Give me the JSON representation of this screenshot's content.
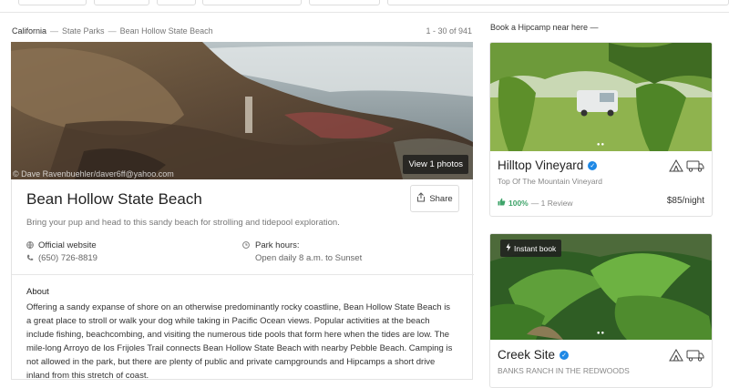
{
  "breadcrumb": [
    "California",
    "State Parks",
    "Bean Hollow State Beach"
  ],
  "result_count": "1 - 30 of 941",
  "hero": {
    "credit": "© Dave Ravenbuehler/daver6ff@yahoo.com",
    "view_photos_label": "View 1 photos"
  },
  "park": {
    "title": "Bean Hollow State Beach",
    "share_label": "Share",
    "tagline": "Bring your pup and head to this sandy beach for strolling and tidepool exploration.",
    "website_label": "Official website",
    "phone": "(650) 726-8819",
    "hours_label": "Park hours:",
    "hours_value": "Open daily 8 a.m. to Sunset",
    "about_heading": "About",
    "about_text": "Offering a sandy expanse of shore on an otherwise predominantly rocky coastline, Bean Hollow State Beach is a great place to stroll or walk your dog while taking in Pacific Ocean views. Popular activities at the beach include fishing, beachcombing, and visiting the numerous tide pools that form here when the tides are low. The mile-long Arroyo de los Frijoles Trail connects Bean Hollow State Beach with nearby Pebble Beach. Camping is not allowed in the park, but there are plenty of public and private campgrounds and Hipcamps a short drive inland from this stretch of coast."
  },
  "sidebar": {
    "heading": "Book a Hipcamp near here —",
    "camps": [
      {
        "name": "Hilltop Vineyard",
        "subtitle": "Top Of The Mountain Vineyard",
        "rating_pct": "100%",
        "reviews": "— 1 Review",
        "price": "$85/night",
        "instant_book": false
      },
      {
        "name": "Creek Site",
        "subtitle": "BANKS RANCH IN THE REDWOODS",
        "instant_book": true,
        "instant_label": "Instant book"
      }
    ]
  },
  "colors": {
    "accent_green": "#3fa46a",
    "verified_blue": "#1e88e5"
  }
}
